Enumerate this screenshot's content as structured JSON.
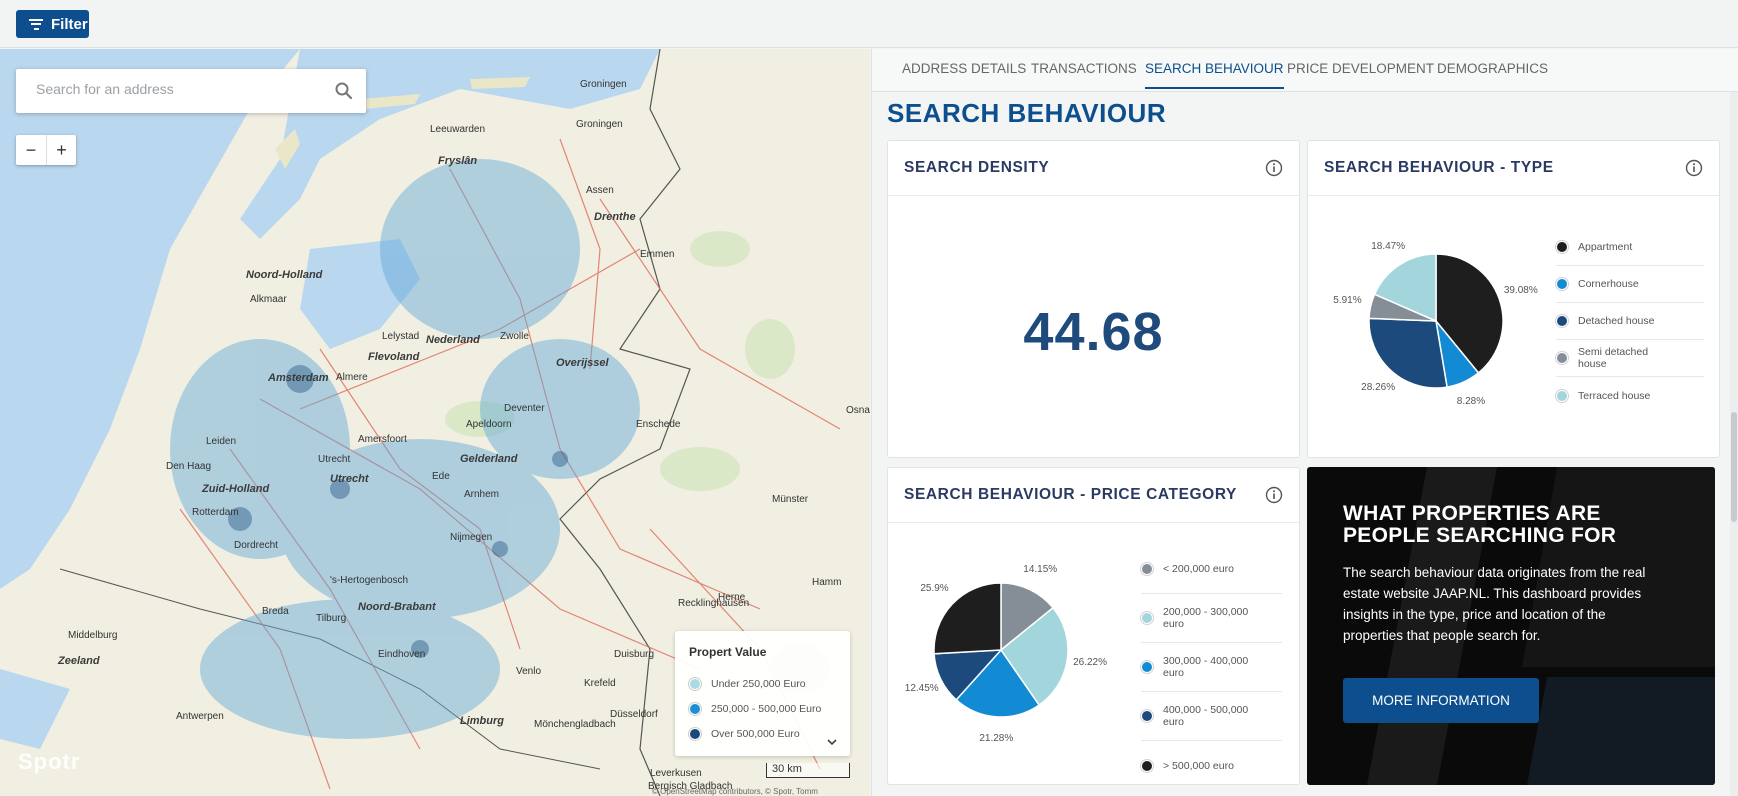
{
  "topbar": {
    "filter_label": "Filter"
  },
  "map": {
    "search_placeholder": "Search for an address",
    "zoom_out": "−",
    "zoom_in": "+",
    "legend": {
      "title": "Propert Value",
      "items": [
        {
          "label": "Under 250,000 Euro",
          "color": "#a9dbe3"
        },
        {
          "label": "250,000 - 500,000 Euro",
          "color": "#1a8fd6"
        },
        {
          "label": "Over 500,000 Euro",
          "color": "#1a4a7a"
        }
      ]
    },
    "scale_label": "30 km",
    "attribution": "© OpenStreetMap contributors, © Spotr, Tomm",
    "logo_text": "Spotr",
    "places": [
      "Groningen",
      "Leeuwarden",
      "Groningen",
      "Fryslân",
      "Assen",
      "Drenthe",
      "Emmen",
      "Noord-Holland",
      "Alkmaar",
      "Lelystad",
      "Nederland",
      "Zwolle",
      "Flevoland",
      "Amsterdam",
      "Almere",
      "Overijssel",
      "Apeldoorn",
      "Deventer",
      "Enschede",
      "Amersfoort",
      "Leiden",
      "Utrecht",
      "Gelderland",
      "Den Haag",
      "Zuid-Holland",
      "Utrecht",
      "Ede",
      "Arnhem",
      "Rotterdam",
      "Münster",
      "Dordrecht",
      "Nijmegen",
      "'s-Hertogenbosch",
      "Recklinghausen",
      "Hamm",
      "Breda",
      "Tilburg",
      "Noord-Brabant",
      "Middelburg",
      "Eindhoven",
      "Duisburg",
      "Zeeland",
      "Venlo",
      "Krefeld",
      "Antwerpen",
      "Limburg",
      "Mönchengladbach",
      "Düsseldorf",
      "Leverkusen",
      "Bergisch Gladbach",
      "Osna",
      "Herne"
    ]
  },
  "tabs": [
    {
      "label": "ADDRESS DETAILS",
      "active": false
    },
    {
      "label": "TRANSACTIONS",
      "active": false
    },
    {
      "label": "SEARCH BEHAVIOUR",
      "active": true
    },
    {
      "label": "PRICE DEVELOPMENT",
      "active": false
    },
    {
      "label": "DEMOGRAPHICS",
      "active": false
    }
  ],
  "page_title": "SEARCH BEHAVIOUR",
  "density": {
    "title": "SEARCH DENSITY",
    "value": "44.68"
  },
  "type_card": {
    "title": "SEARCH BEHAVIOUR - TYPE"
  },
  "price_card": {
    "title": "SEARCH BEHAVIOUR - PRICE CATEGORY"
  },
  "chart_data": [
    {
      "type": "pie",
      "title": "SEARCH BEHAVIOUR - TYPE",
      "legend_position": "right",
      "slices": [
        {
          "label": "Appartment",
          "value": 39.08,
          "display": "39.08%",
          "color": "#1e1e1e"
        },
        {
          "label": "Cornerhouse",
          "value": 8.28,
          "display": "8.28%",
          "color": "#138bd4"
        },
        {
          "label": "Detached house",
          "value": 28.26,
          "display": "28.26%",
          "color": "#1c4a7c"
        },
        {
          "label": "Semi detached house",
          "value": 5.91,
          "display": "5.91%",
          "color": "#858e97"
        },
        {
          "label": "Terraced house",
          "value": 18.47,
          "display": "18.47%",
          "color": "#a3d6dc"
        }
      ]
    },
    {
      "type": "pie",
      "title": "SEARCH BEHAVIOUR - PRICE CATEGORY",
      "legend_position": "right",
      "slices": [
        {
          "label": "< 200,000 euro",
          "value": 14.15,
          "display": "14.15%",
          "color": "#858e97"
        },
        {
          "label": "200,000 - 300,000 euro",
          "value": 26.22,
          "display": "26.22%",
          "color": "#a3d6dc"
        },
        {
          "label": "300,000 - 400,000 euro",
          "value": 21.28,
          "display": "21.28%",
          "color": "#138bd4"
        },
        {
          "label": "400,000 - 500,000 euro",
          "value": 12.45,
          "display": "12.45%",
          "color": "#1c4a7c"
        },
        {
          "label": "> 500,000 euro",
          "value": 25.9,
          "display": "25.9%",
          "color": "#1e1e1e"
        }
      ]
    }
  ],
  "promo": {
    "title": "WHAT PROPERTIES ARE PEOPLE SEARCHING FOR",
    "text": "The search behaviour data originates from the real estate website JAAP.NL. This dashboard provides insights in the type, price and location of the properties that people search for.",
    "button": "MORE INFORMATION"
  }
}
